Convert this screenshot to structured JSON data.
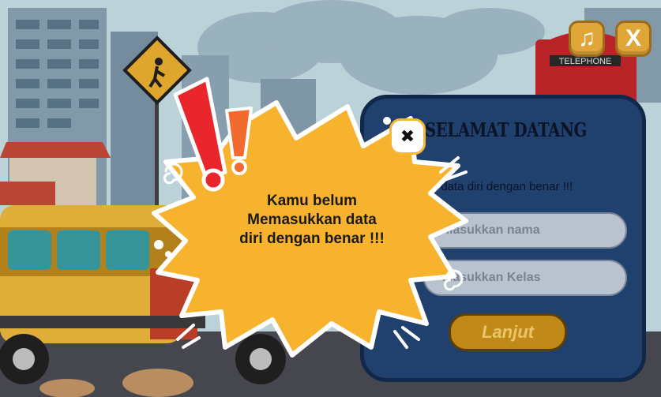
{
  "controls": {
    "music_icon": "music-note-icon",
    "close_icon": "close-icon",
    "close_label": "X",
    "music_label": "♫"
  },
  "scene": {
    "sign_text": "TELEPHONE"
  },
  "panel": {
    "title": "SELAMAT DATANG",
    "subtitle": "isi data diri dengan benar !!!",
    "name_placeholder": "Masukkan nama",
    "class_placeholder": "Masukkan Kelas",
    "submit_label": "Lanjut"
  },
  "alert": {
    "message_line1": "Kamu belum",
    "message_line2": "Memasukkan data",
    "message_line3": "diri dengan benar !!!",
    "close_symbol": "✖"
  },
  "colors": {
    "panel": "#20406d",
    "burst": "#f7b22e",
    "button": "#c18a18",
    "exclamation_red": "#e8262b",
    "exclamation_orange": "#f26a2e"
  }
}
